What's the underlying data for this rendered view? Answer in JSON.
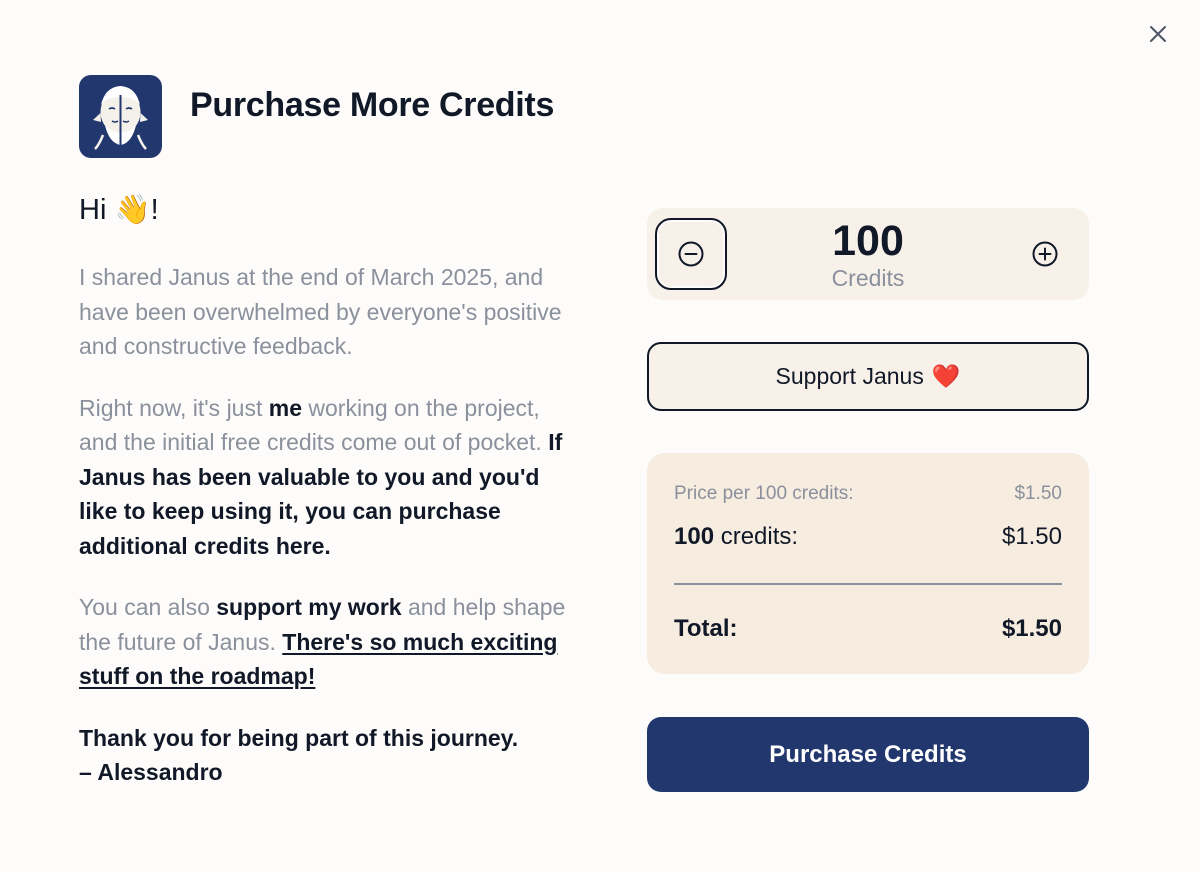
{
  "dialog": {
    "title": "Purchase More Credits",
    "close_icon": "close-icon",
    "logo_icon": "janus-logo"
  },
  "message": {
    "greeting_prefix": "Hi ",
    "greeting_emoji": "👋",
    "greeting_suffix": "!",
    "p1": "I shared Janus at the end of March 2025, and have been overwhelmed by everyone's positive and constructive feedback.",
    "p2_part1": "Right now, it's just ",
    "p2_bold1": "me",
    "p2_part2": " working on the project, and the initial free credits come out of pocket. ",
    "p2_bold2": "If Janus has been valuable to you and you'd like to keep using it, you can purchase additional credits here.",
    "p3_part1": "You can also ",
    "p3_bold": "support my work",
    "p3_part2": " and help shape the future of Janus. ",
    "p3_link": "There's so much exciting stuff on the roadmap!",
    "signoff_line1": "Thank you for being part of this journey.",
    "signoff_line2": "– Alessandro"
  },
  "stepper": {
    "value": "100",
    "unit": "Credits",
    "minus_icon": "minus-circle-icon",
    "plus_icon": "plus-circle-icon"
  },
  "support_button": {
    "label": "Support Janus",
    "emoji": "❤️"
  },
  "summary": {
    "price_label": "Price per 100 credits:",
    "price_value": "$1.50",
    "credits_count": "100",
    "credits_label": " credits:",
    "credits_value": "$1.50",
    "total_label": "Total:",
    "total_value": "$1.50"
  },
  "purchase_button": {
    "label": "Purchase Credits"
  },
  "colors": {
    "brand": "#23376f",
    "muted_text": "#8a909c",
    "panel": "#f7ece0",
    "background": "#fdfcfa"
  }
}
